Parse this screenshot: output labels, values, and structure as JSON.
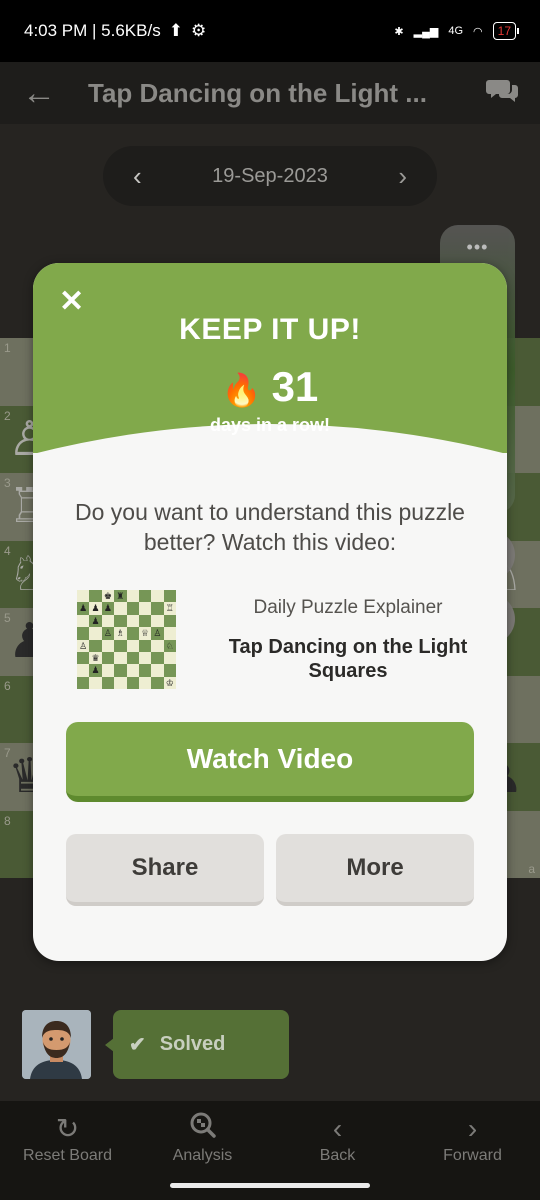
{
  "status_bar": {
    "time_speed": "4:03 PM | 5.6KB/s",
    "network": "4G",
    "battery": "17"
  },
  "header": {
    "title": "Tap Dancing on the Light ..."
  },
  "date_nav": {
    "date": "19-Sep-2023"
  },
  "board": {
    "rank_labels": [
      "1",
      "2",
      "3",
      "4",
      "5",
      "6",
      "7",
      "8"
    ],
    "file_label": "a"
  },
  "modal": {
    "headline": "KEEP IT UP!",
    "streak_count": "31",
    "streak_text": "days in a row!",
    "question": "Do you want to understand this puzzle better? Watch this video:",
    "video_subtitle": "Daily Puzzle Explainer",
    "video_title": "Tap Dancing on the Light Squares",
    "watch_label": "Watch Video",
    "share_label": "Share",
    "more_label": "More"
  },
  "player": {
    "status": "Solved"
  },
  "bottom_nav": [
    {
      "label": "Reset Board",
      "icon": "reset-icon"
    },
    {
      "label": "Analysis",
      "icon": "analysis-icon"
    },
    {
      "label": "Back",
      "icon": "chevron-left-icon"
    },
    {
      "label": "Forward",
      "icon": "chevron-right-icon"
    }
  ],
  "colors": {
    "accent_green": "#81a94b",
    "modal_bg": "#f7f7f6",
    "app_bg": "#262421"
  }
}
